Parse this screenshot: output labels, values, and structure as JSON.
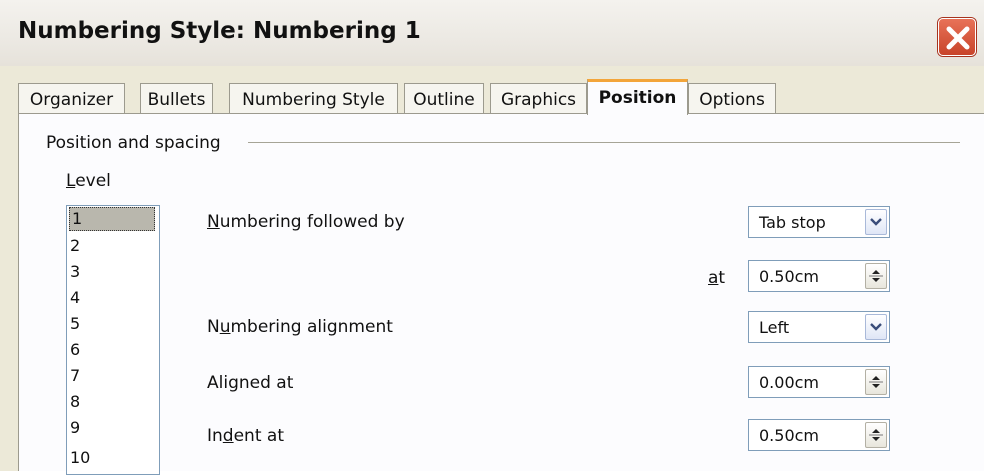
{
  "window": {
    "title": "Numbering Style: Numbering 1"
  },
  "tabs": [
    {
      "label": "Organizer"
    },
    {
      "label": "Bullets"
    },
    {
      "label": "Numbering Style"
    },
    {
      "label": "Outline"
    },
    {
      "label": "Graphics"
    },
    {
      "label": "Position",
      "active": true
    },
    {
      "label": "Options"
    }
  ],
  "section": {
    "title": "Position and spacing"
  },
  "level": {
    "label_pre": "",
    "label_u": "L",
    "label_post": "evel",
    "items": [
      "1",
      "2",
      "3",
      "4",
      "5",
      "6",
      "7",
      "8",
      "9",
      "10"
    ],
    "selected": "1"
  },
  "numbering_followed_by": {
    "label_u": "N",
    "label_post": "umbering followed by",
    "value": "Tab stop"
  },
  "at": {
    "label_u": "a",
    "label_post": "t",
    "value": "0.50cm"
  },
  "numbering_alignment": {
    "label_pre": "N",
    "label_u": "u",
    "label_post": "mbering alignment",
    "value": "Left"
  },
  "aligned_at": {
    "label": "Aligned at",
    "value": "0.00cm"
  },
  "indent_at": {
    "label_pre": "In",
    "label_u": "d",
    "label_post": "ent at",
    "value": "0.50cm"
  },
  "colors": {
    "active_tab_accent": "#f3a53a",
    "close_button": "#d4553a",
    "dialog_bg": "#ece9d8"
  }
}
